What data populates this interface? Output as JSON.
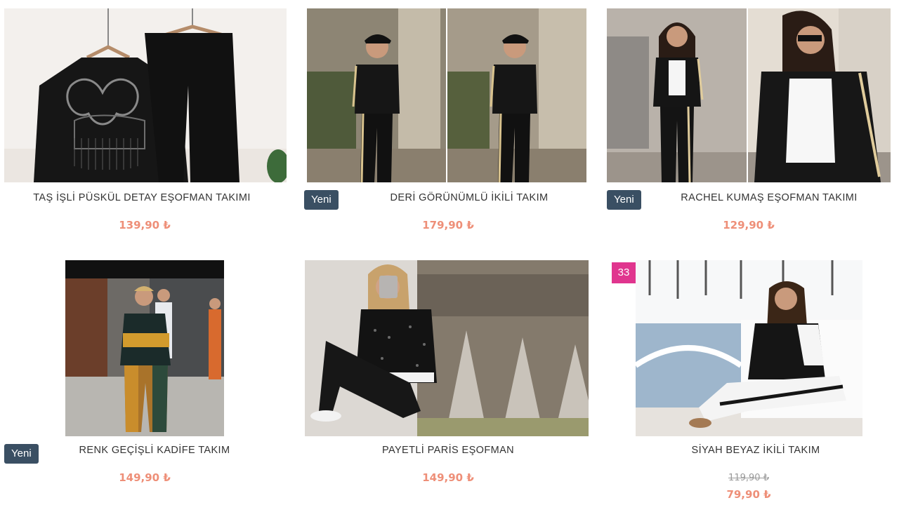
{
  "products": [
    {
      "title": "TAŞ İŞLİ PÜSKÜL DETAY EŞOFMAN TAKIMI",
      "price": "139,90 ₺",
      "image": "black-tracksuit-product-photo"
    },
    {
      "title": "DERİ GÖRÜNÜMLÜ İKİLİ TAKIM",
      "price": "179,90 ₺",
      "badge": "Yeni",
      "image": "model-leather-look-set"
    },
    {
      "title": "RACHEL KUMAŞ EŞOFMAN TAKIMI",
      "price": "129,90 ₺",
      "badge": "Yeni",
      "image": "model-striped-bomber-set"
    },
    {
      "title": "RENK GEÇİŞLİ KADİFE TAKIM",
      "price": "149,90 ₺",
      "badge": "Yeni",
      "image": "model-velvet-gradient-set"
    },
    {
      "title": "PAYETLİ PARİS EŞOFMAN",
      "price": "149,90 ₺",
      "image": "model-sequin-paris-tracksuit"
    },
    {
      "title": "SİYAH BEYAZ İKİLİ TAKIM",
      "old_price": "119,90 ₺",
      "price": "79,90 ₺",
      "discount": "33",
      "image": "model-black-white-set"
    }
  ]
}
